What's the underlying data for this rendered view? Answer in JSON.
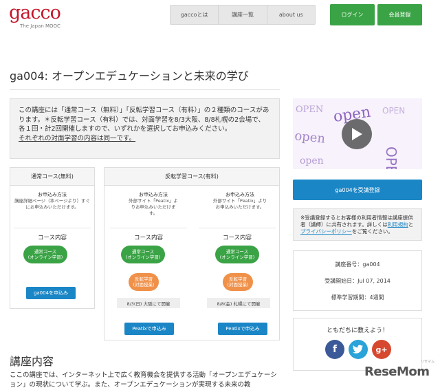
{
  "header": {
    "logo": "gacco",
    "logo_sub": "The Japan MOOC",
    "nav": [
      "gaccoとは",
      "講座一覧",
      "about us"
    ],
    "login": "ログイン",
    "signup": "会員登録"
  },
  "page_title": "ga004: オープンエデュケーションと未来の学び",
  "notice": {
    "line1": "この講座には「通常コース（無料）」「反転学習コース（有料）」の２種類のコースがあります。＊反転学習コース（有料）では、対面学習を8/3大阪、8/8札幌の2会場で、各１回・計2回開催しますので、いずれかを選択してお申込みください。",
    "line2": "それぞれの対面学習の内容は同一です。"
  },
  "normal_course": {
    "heading": "通常コース(無料)",
    "apply_title": "お申込み方法",
    "apply_text": "講座詳細ページ（本ページより）すぐにお申込みいただけます。",
    "content_label": "コース内容",
    "pill_line1": "通常コース",
    "pill_line2": "(オンライン学習)",
    "button": "ga004を申込み"
  },
  "flip_course": {
    "heading": "反転学習コース(有料)",
    "options": [
      {
        "apply_title": "お申込み方法",
        "apply_text": "外部サイト「Peatix」よりお申込みいただけます。",
        "content_label": "コース内容",
        "pill_green_line1": "通常コース",
        "pill_green_line2": "(オンライン学習)",
        "pill_orange_line1": "反転学習",
        "pill_orange_line2": "(対面授業)",
        "date": "8/3(日) 大阪にて開催",
        "button": "Peatixで申込み"
      },
      {
        "apply_title": "お申込み方法",
        "apply_text": "外部サイト「Peatix」よりお申込みいただけます。",
        "content_label": "コース内容",
        "pill_green_line1": "通常コース",
        "pill_green_line2": "(オンライン学習)",
        "pill_orange_line1": "反転学習",
        "pill_orange_line2": "(対面授業)",
        "date": "8/8(金) 札幌にて開催",
        "button": "Peatixで申込み"
      }
    ]
  },
  "video": {
    "words": [
      "OPEN",
      "open",
      "OPEN",
      "open",
      "OPEN",
      "open"
    ]
  },
  "register_button": "ga004を受講登録",
  "privacy": {
    "text": "※受講登録するとお客様の利用者情報は講座提供者（講師）に共有されます。詳しくは",
    "terms": "利用規約",
    "and": "と",
    "policy": "プライバシーポリシー",
    "end": "をご覧ください。"
  },
  "course_info": [
    "講座番号：ga004",
    "受講開始日：Jul 07, 2014",
    "標準学習期間：4週間"
  ],
  "share": {
    "title": "ともだちに教えよう！",
    "icons": [
      "facebook-icon",
      "twitter-icon",
      "google-plus-icon"
    ]
  },
  "section_title": "講座内容",
  "description": "ここの講座では、インターネット上で広く教育機会を提供する活動「オープンエデュケーション」の現状について学ぶ。また、オープンエデュケーションが実現する未来の教",
  "watermark": "ReseMom",
  "watermark_sub": "リセマム",
  "colors": {
    "green": "#3aa345",
    "blue": "#1b86c6",
    "orange": "#f0914a",
    "logo_red": "#c4162a"
  }
}
